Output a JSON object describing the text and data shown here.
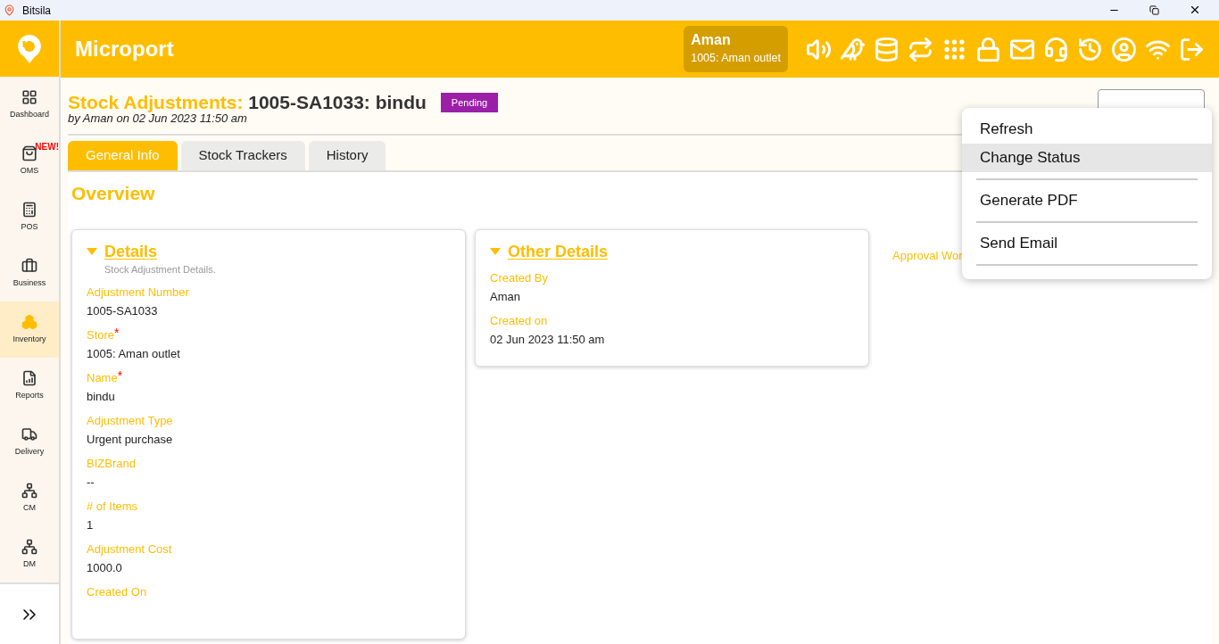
{
  "window": {
    "title": "Bitsila"
  },
  "header": {
    "brand": "Microport",
    "user": {
      "name": "Aman",
      "store": "1005: Aman outlet"
    }
  },
  "sidebar": {
    "items": [
      {
        "label": "Dashboard",
        "selected": false
      },
      {
        "label": "OMS",
        "selected": false,
        "badge": "NEW!"
      },
      {
        "label": "POS",
        "selected": false
      },
      {
        "label": "Business",
        "selected": false
      },
      {
        "label": "Inventory",
        "selected": true
      },
      {
        "label": "Reports",
        "selected": false
      },
      {
        "label": "Delivery",
        "selected": false
      },
      {
        "label": "CM",
        "selected": false
      },
      {
        "label": "DM",
        "selected": false
      }
    ]
  },
  "page": {
    "title_prefix": "Stock Adjustments:",
    "title": "1005-SA1033: bindu",
    "status": "Pending",
    "subtitle": "by Aman on 02 Jun 2023 11:50 am"
  },
  "tabs": [
    {
      "label": "General Info",
      "selected": true
    },
    {
      "label": "Stock Trackers",
      "selected": false
    },
    {
      "label": "History",
      "selected": false
    }
  ],
  "section_title": "Overview",
  "cards": [
    {
      "title": "Details",
      "subtitle": "Stock Adjustment Details.",
      "expanded": true,
      "fields": [
        {
          "label": "Adjustment Number",
          "value": "1005-SA1033"
        },
        {
          "label": "Store",
          "value": "1005: Aman outlet",
          "marker": "*"
        },
        {
          "label": "Name",
          "value": "bindu",
          "marker": "*"
        },
        {
          "label": "Adjustment Type",
          "value": "Urgent purchase"
        },
        {
          "label": "BIZBrand",
          "value": "--"
        },
        {
          "label": "# of Items",
          "value": "1"
        },
        {
          "label": "Adjustment Cost",
          "value": "1000.0"
        },
        {
          "label": "Created On"
        }
      ]
    },
    {
      "title": "Other Details",
      "expanded": true,
      "fields": [
        {
          "label": "Created By",
          "value": "Aman"
        },
        {
          "label": "Created on",
          "value": "02 Jun 2023 11:50 am"
        }
      ]
    }
  ],
  "approval_label": "Approval Wor",
  "menu": {
    "items": [
      {
        "label": "Refresh",
        "selected": false
      },
      {
        "label": "Change Status",
        "selected": true
      },
      {
        "label": "Generate PDF",
        "selected": false
      },
      {
        "label": "Send Email",
        "selected": false
      }
    ]
  }
}
